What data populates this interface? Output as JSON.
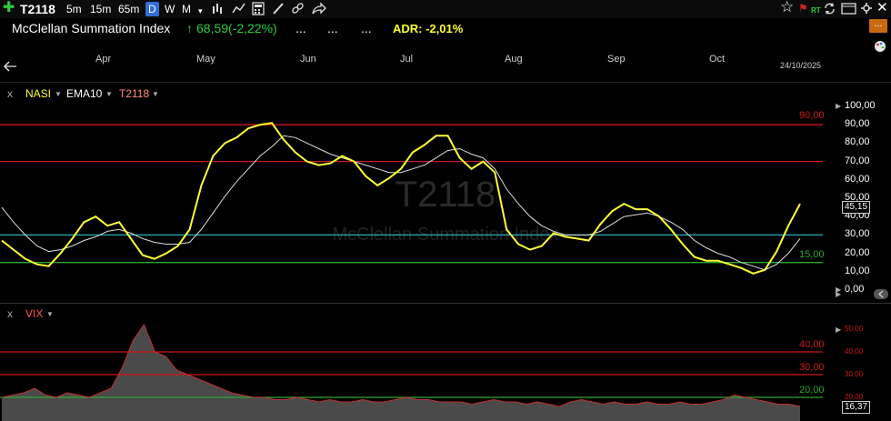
{
  "toolbar": {
    "symbol": "T2118",
    "periods": [
      "5m",
      "15m",
      "65m",
      "D",
      "W",
      "M"
    ],
    "active_period": "D",
    "period_more": "▾"
  },
  "header": {
    "title": "McClellan Summation Index",
    "change": "68,59(-2,22%)",
    "dots1": "...",
    "dots2": "...",
    "dots3": "...",
    "adr": "ADR: -2,01%",
    "more_btn": "..."
  },
  "time_axis": {
    "months": [
      "Apr",
      "May",
      "Jun",
      "Jul",
      "Aug",
      "Sep",
      "Oct"
    ],
    "date": "24/10/2025"
  },
  "main_pane": {
    "close": "x",
    "legend": [
      "NASI",
      "EMA10",
      "T2118"
    ],
    "watermark_symbol": "T2118",
    "watermark_name": "McClellan Summation Index",
    "axis_labels": [
      "100,00",
      "90,00",
      "80,00",
      "70,00",
      "60,00",
      "50,00",
      "40,00",
      "30,00",
      "20,00",
      "10,00",
      "0,00"
    ],
    "last_value": "45,15",
    "line_label_90": "90,00",
    "line_label_15": "15,00"
  },
  "vix_pane": {
    "close": "x",
    "legend": "VIX",
    "line_label_40": "40,00",
    "line_label_30": "30,00",
    "line_label_20": "20,00",
    "axis_labels": [
      "50,00",
      "40,00",
      "30,00",
      "20,00"
    ],
    "last_value": "16,37"
  },
  "colors": {
    "nasi": "#ffff33",
    "ema": "#dddddd",
    "red_line": "#d01818",
    "cyan_line": "#2ab0b8",
    "green_line": "#2ea82e",
    "vix_fill": "#4a4a4a",
    "vix_stroke": "#c03030"
  },
  "chart_data": [
    {
      "type": "line",
      "title": "McClellan Summation Index",
      "series": [
        {
          "name": "NASI",
          "values": [
            27,
            22,
            17,
            14,
            13,
            20,
            28,
            37,
            40,
            35,
            37,
            28,
            19,
            17,
            20,
            24,
            33,
            57,
            73,
            80,
            83,
            88,
            90,
            91,
            82,
            75,
            70,
            68,
            69,
            73,
            70,
            62,
            57,
            61,
            66,
            75,
            79,
            84,
            84,
            72,
            66,
            70,
            64,
            33,
            25,
            22,
            24,
            31,
            29,
            28,
            27,
            36,
            43,
            47,
            44,
            44,
            40,
            33,
            25,
            18,
            16,
            16,
            14,
            12,
            9,
            11,
            21,
            35,
            47
          ]
        },
        {
          "name": "EMA10",
          "values": [
            45,
            37,
            30,
            24,
            21,
            22,
            24,
            27,
            29,
            32,
            33,
            31,
            28,
            26,
            25,
            25,
            26,
            33,
            42,
            51,
            59,
            66,
            73,
            78,
            84,
            83,
            80,
            77,
            74,
            72,
            70,
            68,
            66,
            64,
            64,
            66,
            68,
            72,
            76,
            77,
            74,
            72,
            66,
            55,
            47,
            40,
            35,
            32,
            30,
            30,
            30,
            32,
            36,
            40,
            41,
            42,
            40,
            37,
            33,
            27,
            23,
            20,
            18,
            15,
            13,
            11,
            14,
            20,
            28
          ]
        }
      ],
      "reference_lines": [
        90,
        70,
        30,
        15
      ],
      "ylim": [
        0,
        100
      ]
    },
    {
      "type": "area",
      "title": "VIX",
      "series": [
        {
          "name": "VIX",
          "values": [
            20,
            21,
            22,
            24,
            21,
            20,
            22,
            21,
            20,
            22,
            24,
            33,
            45,
            52,
            40,
            38,
            32,
            30,
            28,
            26,
            24,
            22,
            21,
            20,
            20,
            19,
            19,
            20,
            19,
            18,
            19,
            18,
            18,
            19,
            18,
            18,
            19,
            20,
            19,
            19,
            18,
            18,
            18,
            17,
            18,
            19,
            18,
            18,
            17,
            18,
            17,
            16,
            18,
            19,
            18,
            17,
            18,
            17,
            17,
            18,
            17,
            17,
            18,
            17,
            17,
            18,
            19,
            21,
            20,
            19,
            18,
            17,
            17,
            16
          ]
        }
      ],
      "reference_lines": [
        40,
        30,
        20
      ],
      "ylim": [
        14,
        55
      ]
    }
  ]
}
